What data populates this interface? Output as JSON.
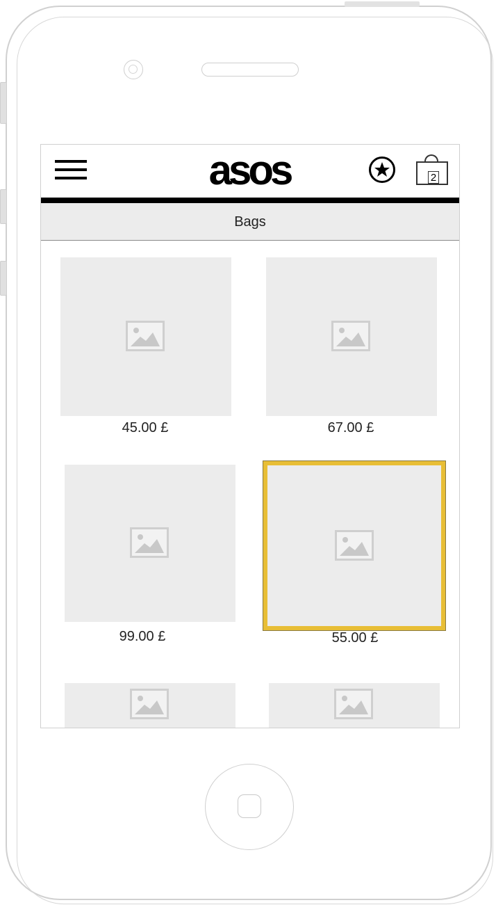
{
  "app": {
    "logo": "asos",
    "cart_count": "2"
  },
  "category": {
    "title": "Bags"
  },
  "products": [
    {
      "price": "45.00 £"
    },
    {
      "price": "67.00 £"
    },
    {
      "price": "99.00 £"
    },
    {
      "price": "55.00 £",
      "selected": true
    },
    {
      "price": ""
    },
    {
      "price": ""
    }
  ],
  "colors": {
    "highlight": "#e8be36",
    "placeholder": "#ececec"
  }
}
